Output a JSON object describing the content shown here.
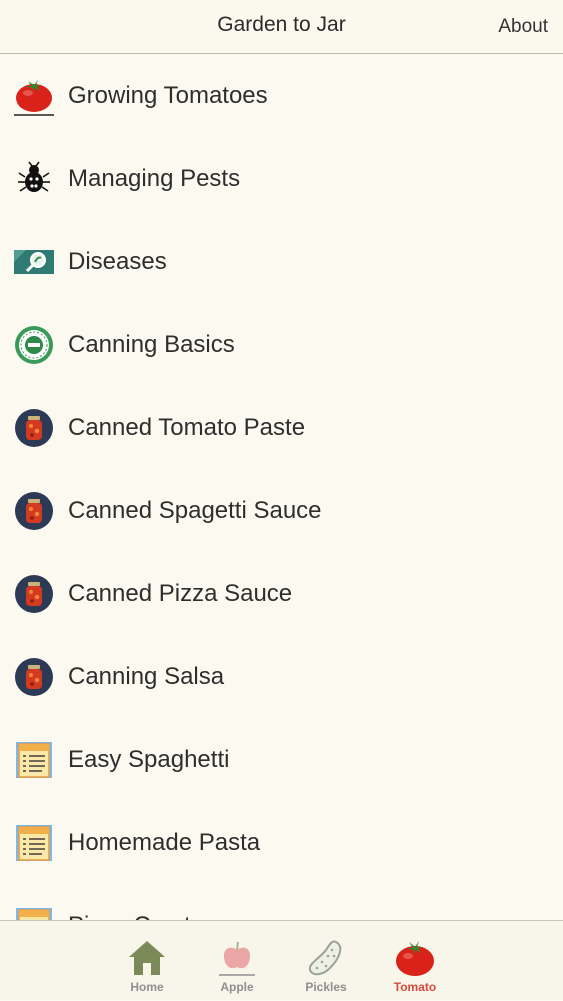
{
  "nav": {
    "title": "Garden to Jar",
    "about_label": "About"
  },
  "list": {
    "items": [
      {
        "label": "Growing Tomatoes",
        "icon": "tomato-icon"
      },
      {
        "label": "Managing Pests",
        "icon": "bug-icon"
      },
      {
        "label": "Diseases",
        "icon": "magnifier-leaf-icon"
      },
      {
        "label": "Canning Basics",
        "icon": "food-safe-badge-icon"
      },
      {
        "label": "Canned Tomato Paste",
        "icon": "canning-jar-icon"
      },
      {
        "label": "Canned Spagetti Sauce",
        "icon": "canning-jar-icon"
      },
      {
        "label": "Canned Pizza Sauce",
        "icon": "canning-jar-icon"
      },
      {
        "label": "Canning Salsa",
        "icon": "canning-jar-icon"
      },
      {
        "label": "Easy Spaghetti",
        "icon": "recipe-card-icon"
      },
      {
        "label": "Homemade Pasta",
        "icon": "recipe-card-icon"
      },
      {
        "label": "Pizza Crust",
        "icon": "recipe-card-icon"
      }
    ]
  },
  "tabs": [
    {
      "label": "Home",
      "icon": "home-icon",
      "active": false
    },
    {
      "label": "Apple",
      "icon": "apple-icon",
      "active": false
    },
    {
      "label": "Pickles",
      "icon": "pickle-icon",
      "active": false
    },
    {
      "label": "Tomato",
      "icon": "tomato-icon",
      "active": true
    }
  ],
  "colors": {
    "background": "#fcfaf0",
    "active_tab": "#d54a3c",
    "inactive_tab": "#8f8f8f"
  }
}
